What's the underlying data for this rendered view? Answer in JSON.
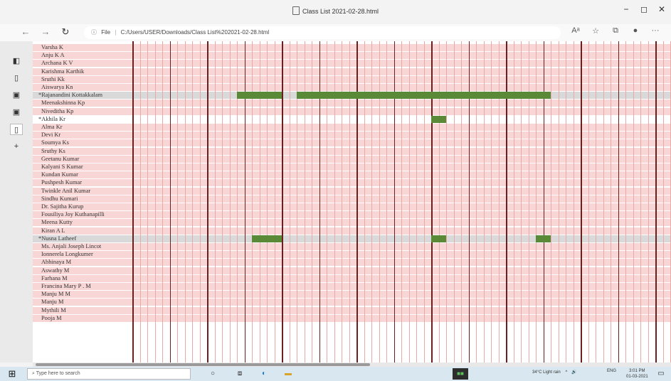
{
  "window": {
    "title": "Class List 2021-02-28.html",
    "minimize": "−",
    "maximize": "◻",
    "close": "✕"
  },
  "nav": {
    "back": "←",
    "forward": "→",
    "refresh": "↻",
    "address_prefix": "File",
    "address": "C:/Users/USER/Downloads/Class List%202021-02-28.html",
    "more": "···"
  },
  "students": [
    {
      "name": "Varsha K",
      "star": false
    },
    {
      "name": "Anju K A",
      "star": false
    },
    {
      "name": "Archana K V",
      "star": false
    },
    {
      "name": "Karishma Karthik",
      "star": false
    },
    {
      "name": "Sruthi Kk",
      "star": false
    },
    {
      "name": "Aiswarya Kn",
      "star": false
    },
    {
      "name": "Rajanandini Kottakkalam",
      "star": true
    },
    {
      "name": "Meenakshinna Kp",
      "star": false
    },
    {
      "name": "Niveditha Kp",
      "star": false
    },
    {
      "name": "Akhila Kr",
      "star": true
    },
    {
      "name": "Alma Kr",
      "star": false
    },
    {
      "name": "Devi Kr",
      "star": false
    },
    {
      "name": "Soumya Ks",
      "star": false
    },
    {
      "name": "Sruthy Ks",
      "star": false
    },
    {
      "name": "Geetanu Kumar",
      "star": false
    },
    {
      "name": "Kalyani S Kumar",
      "star": false
    },
    {
      "name": "Kundan Kumar",
      "star": false
    },
    {
      "name": "Pushpesh Kumar",
      "star": false
    },
    {
      "name": "Twinkle Anil Kumar",
      "star": false
    },
    {
      "name": "Sindhu Kumari",
      "star": false
    },
    {
      "name": "Dr. Sajitha Kurup",
      "star": false
    },
    {
      "name": "Fousiliya Joy Kuthanapilli",
      "star": false
    },
    {
      "name": "Meena Kutty",
      "star": false
    },
    {
      "name": "Kiran A L",
      "star": false
    },
    {
      "name": "Nusna Latheef",
      "star": true
    },
    {
      "name": "Ms. Anjali Joseph Lincot",
      "star": false
    },
    {
      "name": "Ionnerela Longkumer",
      "star": false
    },
    {
      "name": "Abhinaya M",
      "star": false
    },
    {
      "name": "Aswathy M",
      "star": false
    },
    {
      "name": "Farhana M",
      "star": false
    },
    {
      "name": "Francina Mary P . M",
      "star": false
    },
    {
      "name": "Manju M M",
      "star": false
    },
    {
      "name": "Manju M",
      "star": false
    },
    {
      "name": "Mythili M",
      "star": false
    },
    {
      "name": "Pooja M",
      "star": false
    }
  ],
  "attendance": [
    {
      "row": 6,
      "from": 7,
      "to": 9
    },
    {
      "row": 6,
      "from": 11,
      "to": 27
    },
    {
      "row": 9,
      "from": 20,
      "to": 20
    },
    {
      "row": 24,
      "from": 8,
      "to": 9
    },
    {
      "row": 24,
      "from": 20,
      "to": 20
    },
    {
      "row": 24,
      "from": 27,
      "to": 27
    }
  ],
  "colors": {
    "row_bg": "#f9d6d6",
    "highlight_row": "#d9d9d9",
    "white_row": "#ffffff",
    "present": "#5a8a37",
    "grid_major": "#6b2020",
    "grid_minor": "#e9a9a9"
  },
  "taskbar": {
    "start": "⊞",
    "search_placeholder": "Type here to search",
    "weather": "34°C Light rain",
    "lang": "ENG",
    "time": "3:01 PM",
    "date": "01-03-2021"
  }
}
